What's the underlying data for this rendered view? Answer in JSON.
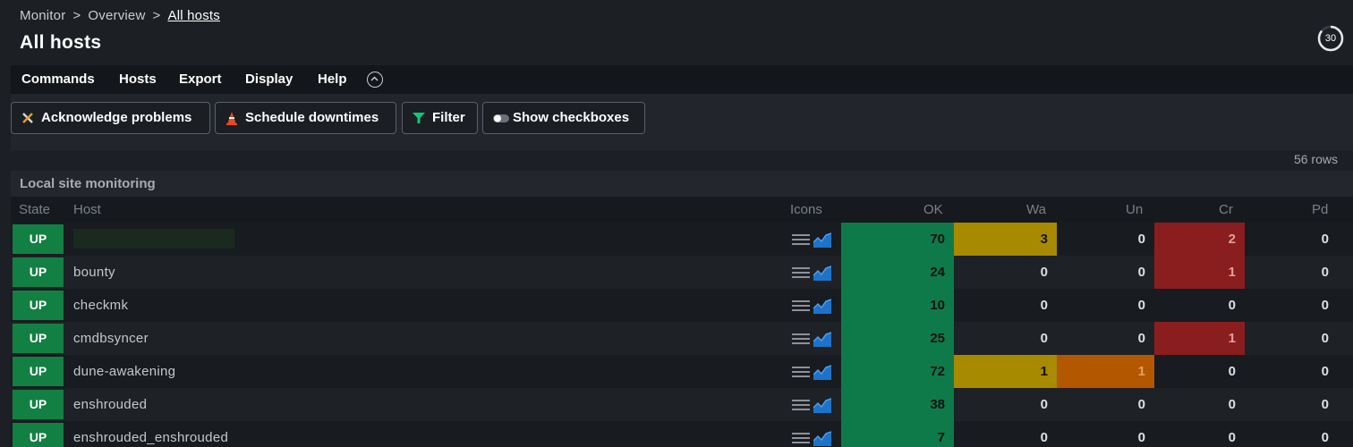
{
  "breadcrumb": {
    "items": [
      "Monitor",
      "Overview"
    ],
    "current": "All hosts",
    "separator": ">"
  },
  "page": {
    "title": "All hosts"
  },
  "refresh": {
    "seconds": "30"
  },
  "menu": {
    "items": [
      "Commands",
      "Hosts",
      "Export",
      "Display",
      "Help"
    ]
  },
  "toolbar": {
    "acknowledge": "Acknowledge problems",
    "schedule": "Schedule downtimes",
    "filter": "Filter",
    "checkboxes": "Show checkboxes"
  },
  "table": {
    "row_count": "56 rows",
    "group": "Local site monitoring",
    "columns": {
      "state": "State",
      "host": "Host",
      "icons": "Icons",
      "ok": "OK",
      "wa": "Wa",
      "un": "Un",
      "cr": "Cr",
      "pd": "Pd"
    },
    "rows": [
      {
        "state": "UP",
        "host": "",
        "redacted": true,
        "ok": "70",
        "wa": "3",
        "un": "0",
        "cr": "2",
        "pd": "0"
      },
      {
        "state": "UP",
        "host": "bounty",
        "ok": "24",
        "wa": "0",
        "un": "0",
        "cr": "1",
        "pd": "0"
      },
      {
        "state": "UP",
        "host": "checkmk",
        "ok": "10",
        "wa": "0",
        "un": "0",
        "cr": "0",
        "pd": "0"
      },
      {
        "state": "UP",
        "host": "cmdbsyncer",
        "ok": "25",
        "wa": "0",
        "un": "0",
        "cr": "1",
        "pd": "0"
      },
      {
        "state": "UP",
        "host": "dune-awakening",
        "ok": "72",
        "wa": "1",
        "un": "1",
        "cr": "0",
        "pd": "0"
      },
      {
        "state": "UP",
        "host": "enshrouded",
        "ok": "38",
        "wa": "0",
        "un": "0",
        "cr": "0",
        "pd": "0"
      },
      {
        "state": "UP",
        "host": "enshrouded_enshrouded",
        "ok": "7",
        "wa": "0",
        "un": "0",
        "cr": "0",
        "pd": "0"
      }
    ]
  },
  "colors": {
    "ok": "#0f7a49",
    "warn": "#a88a00",
    "unknown": "#b35700",
    "crit": "#8a1e1e",
    "up": "#138043"
  },
  "icons": {
    "row_menu": "hamburger-menu-icon",
    "row_graph": "area-graph-icon",
    "acknowledge": "wrench-screwdriver-icon",
    "downtime": "traffic-cone-icon",
    "filter": "funnel-icon",
    "checkboxes": "toggle-icon",
    "collapse": "chevron-up-circle-icon"
  }
}
